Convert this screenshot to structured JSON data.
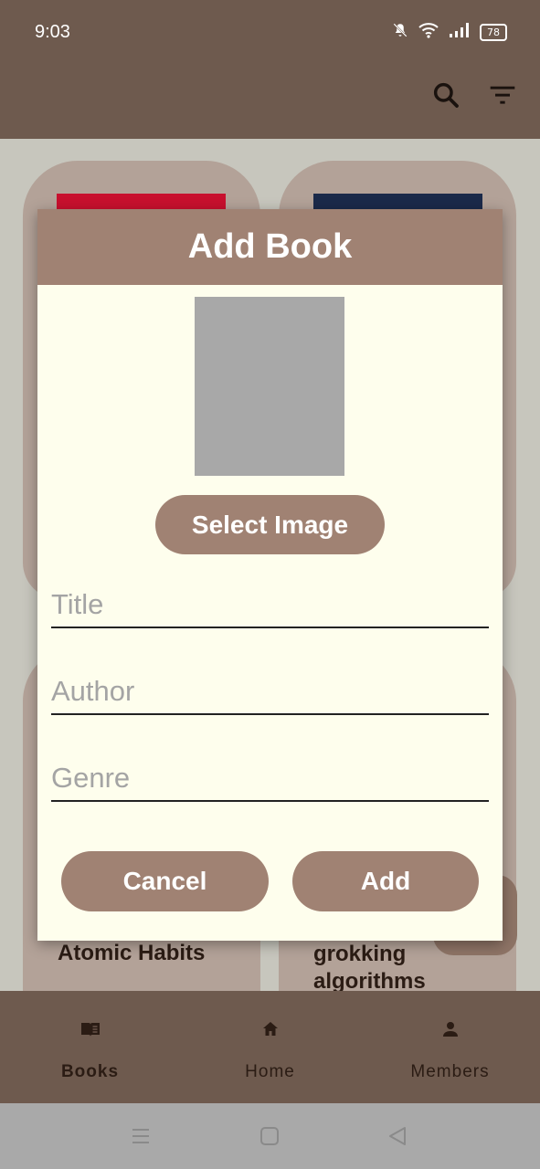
{
  "status_bar": {
    "time": "9:03",
    "battery": "78",
    "icons": [
      "bell-muted-icon",
      "wifi-icon",
      "signal-icon",
      "battery-icon"
    ]
  },
  "app_bar": {
    "icons": [
      "search-icon",
      "filter-icon"
    ]
  },
  "books": [
    {
      "title": "Atomic Habits",
      "cover_color": "#c8102e"
    },
    {
      "title": "grokking algorithms",
      "cover_color": "#1b2a4a"
    }
  ],
  "dialog": {
    "title": "Add Book",
    "select_image_label": "Select Image",
    "fields": [
      {
        "name": "title",
        "placeholder": "Title",
        "value": ""
      },
      {
        "name": "author",
        "placeholder": "Author",
        "value": ""
      },
      {
        "name": "genre",
        "placeholder": "Genre",
        "value": ""
      }
    ],
    "cancel_label": "Cancel",
    "add_label": "Add"
  },
  "bottom_nav": {
    "items": [
      {
        "label": "Books",
        "icon": "book-icon",
        "active": true
      },
      {
        "label": "Home",
        "icon": "home-icon",
        "active": false
      },
      {
        "label": "Members",
        "icon": "person-icon",
        "active": false
      }
    ]
  },
  "system_nav": {
    "icons": [
      "menu-icon",
      "home-square-icon",
      "back-icon"
    ]
  },
  "colors": {
    "primary_brown": "#6e5a4e",
    "accent_brown": "#a08273",
    "dialog_bg": "#fefeed"
  }
}
